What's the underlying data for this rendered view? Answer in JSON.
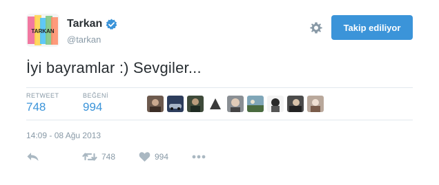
{
  "user": {
    "name": "Tarkan",
    "handle": "@tarkan",
    "avatar_text": "TARKAN",
    "verified_icon": "verified-badge-icon"
  },
  "header": {
    "follow_label": "Takip ediliyor",
    "settings_icon": "gear-icon"
  },
  "tweet": {
    "text": "İyi bayramlar :) Sevgiler..."
  },
  "stats": {
    "retweet_label": "RETWEET",
    "retweet_count": "748",
    "like_label": "BEĞENİ",
    "like_count": "994"
  },
  "timestamp": "14:09 - 08 Ağu 2013",
  "actions": {
    "reply_icon": "reply-icon",
    "retweet_icon": "retweet-icon",
    "retweet_count": "748",
    "like_icon": "heart-icon",
    "like_count": "994",
    "more_icon": "more-icon"
  },
  "colors": {
    "accent": "#3b94d9",
    "text": "#292f33",
    "muted": "#8899a6",
    "divider": "#e1e8ed"
  },
  "liker_avatars": [
    {
      "name": "liker-avatar-1"
    },
    {
      "name": "liker-avatar-2"
    },
    {
      "name": "liker-avatar-3"
    },
    {
      "name": "liker-avatar-4"
    },
    {
      "name": "liker-avatar-5"
    },
    {
      "name": "liker-avatar-6"
    },
    {
      "name": "liker-avatar-7"
    },
    {
      "name": "liker-avatar-8"
    },
    {
      "name": "liker-avatar-9"
    }
  ]
}
